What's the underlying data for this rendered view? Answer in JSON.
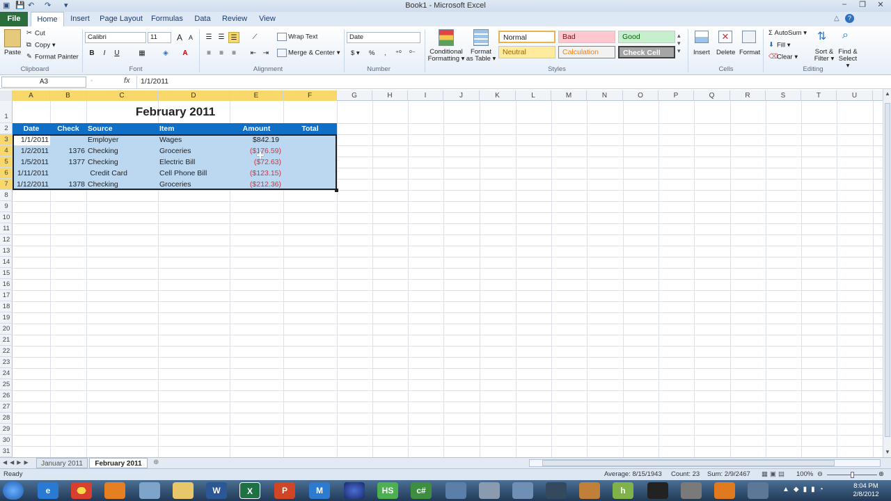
{
  "window": {
    "title": "Book1 - Microsoft Excel",
    "min": "–",
    "max": "❐",
    "close": "✕"
  },
  "qat": {
    "save": "💾",
    "undo": "↶",
    "redo": "↷",
    "more": "▾"
  },
  "tabs": [
    "File",
    "Home",
    "Insert",
    "Page Layout",
    "Formulas",
    "Data",
    "Review",
    "View"
  ],
  "clipboard": {
    "paste": "Paste",
    "cut": "Cut",
    "copy": "Copy ▾",
    "format_painter": "Format Painter",
    "label": "Clipboard"
  },
  "font": {
    "name": "Calibri",
    "size": "11",
    "bold": "B",
    "italic": "I",
    "underline": "U",
    "grow": "A",
    "shrink": "A",
    "label": "Font"
  },
  "alignment": {
    "wrap": "Wrap Text",
    "merge": "Merge & Center ▾",
    "label": "Alignment"
  },
  "number": {
    "format": "Date",
    "currency": "$ ▾",
    "percent": "%",
    "comma": ",",
    "label": "Number"
  },
  "styles": {
    "conditional": "Conditional\nFormatting ▾",
    "format_table": "Format\nas Table ▾",
    "normal": "Normal",
    "bad": "Bad",
    "good": "Good",
    "neutral": "Neutral",
    "calculation": "Calculation",
    "check_cell": "Check Cell",
    "label": "Styles"
  },
  "cells": {
    "insert": "Insert",
    "delete": "Delete",
    "format": "Format",
    "label": "Cells"
  },
  "editing": {
    "autosum": "Σ AutoSum ▾",
    "fill": "Fill ▾",
    "clear": "Clear ▾",
    "sort": "Sort &\nFilter ▾",
    "find": "Find &\nSelect ▾",
    "label": "Editing"
  },
  "formula_bar": {
    "name_box": "A3",
    "fx": "fx",
    "value": "1/1/2011"
  },
  "columns": [
    "A",
    "B",
    "C",
    "D",
    "E",
    "F",
    "G",
    "H",
    "I",
    "J",
    "K",
    "L",
    "M",
    "N",
    "O",
    "P",
    "Q",
    "R",
    "S",
    "T",
    "U"
  ],
  "rows": [
    "1",
    "2",
    "3",
    "4",
    "5",
    "6",
    "7",
    "8",
    "9",
    "10",
    "11",
    "12",
    "13",
    "14",
    "15",
    "16",
    "17",
    "18",
    "19",
    "20",
    "21",
    "22",
    "23",
    "24",
    "25",
    "26",
    "27",
    "28",
    "29",
    "30",
    "31"
  ],
  "sheet": {
    "title": "February 2011",
    "headers": [
      "Date",
      "Check",
      "Source",
      "Item",
      "Amount",
      "Total"
    ],
    "data": [
      {
        "date": "1/1/2011",
        "check": "",
        "source": "Employer",
        "item": "Wages",
        "amount": "$842.19",
        "negative": false
      },
      {
        "date": "1/2/2011",
        "check": "1376",
        "source": "Checking",
        "item": "Groceries",
        "amount": "($176.59)",
        "negative": true
      },
      {
        "date": "1/5/2011",
        "check": "1377",
        "source": "Checking",
        "item": "Electric Bill",
        "amount": "($72.63)",
        "negative": true
      },
      {
        "date": "1/11/2011",
        "check": "",
        "source": "Credit Card",
        "item": "Cell Phone Bill",
        "amount": "($123.15)",
        "negative": true
      },
      {
        "date": "1/12/2011",
        "check": "1378",
        "source": "Checking",
        "item": "Groceries",
        "amount": "($212.36)",
        "negative": true
      }
    ]
  },
  "sheet_tabs": [
    "January 2011",
    "February 2011"
  ],
  "status": {
    "ready": "Ready",
    "average": "Average: 8/15/1943",
    "count": "Count: 23",
    "sum": "Sum: 2/9/2467",
    "zoom": "100%"
  },
  "taskbar": {
    "time": "8:04 PM",
    "date": "2/8/2012"
  },
  "colors": {
    "header_blue": "#0f6fc6",
    "selection": "#bcd8f0",
    "negative": "#d2323f",
    "file_tab": "#2a6f3b"
  }
}
